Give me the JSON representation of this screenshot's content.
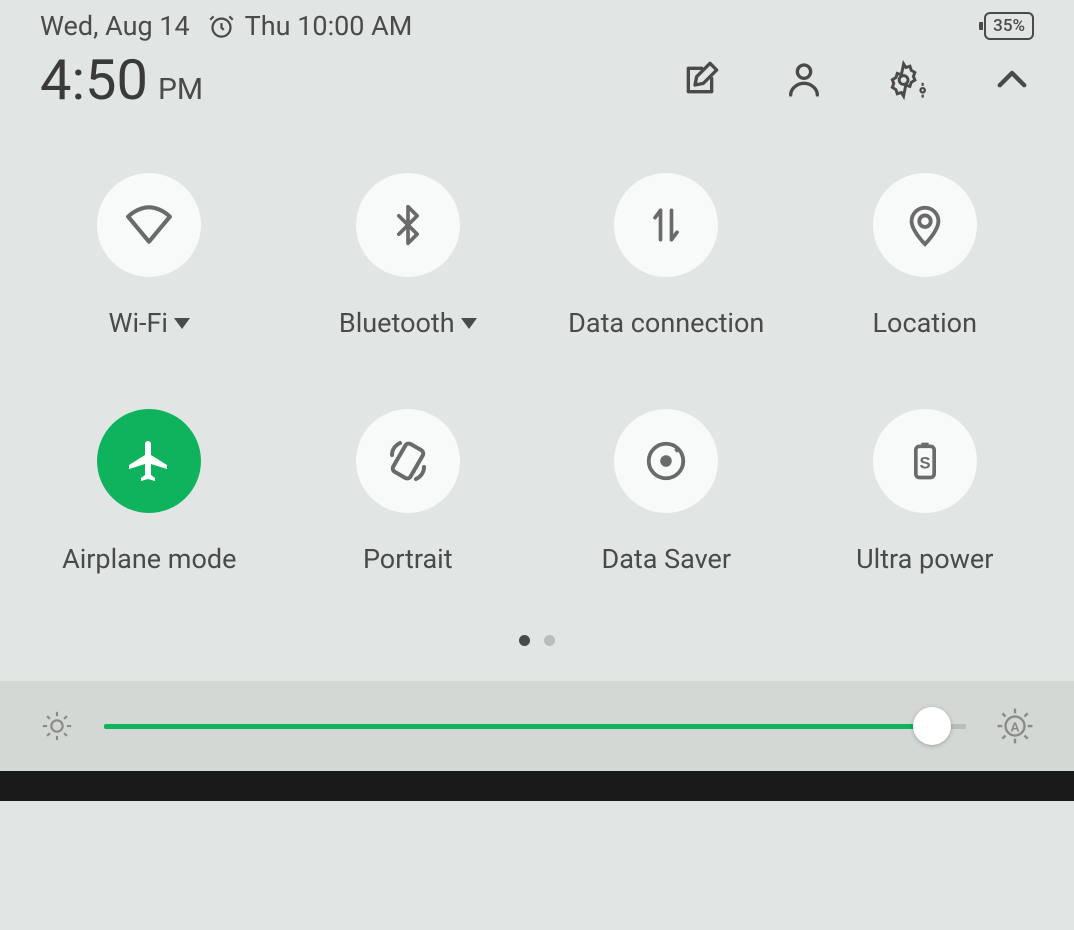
{
  "status": {
    "date": "Wed, Aug 14",
    "alarm_time": "Thu 10:00 AM",
    "battery": "35%"
  },
  "time": {
    "value": "4:50",
    "ampm": "PM"
  },
  "tiles": [
    {
      "label": "Wi-Fi",
      "icon": "wifi",
      "active": false,
      "dropdown": true
    },
    {
      "label": "Bluetooth",
      "icon": "bluetooth",
      "active": false,
      "dropdown": true
    },
    {
      "label": "Data connection",
      "icon": "data",
      "active": false,
      "dropdown": false
    },
    {
      "label": "Location",
      "icon": "location",
      "active": false,
      "dropdown": false
    },
    {
      "label": "Airplane mode",
      "icon": "airplane",
      "active": true,
      "dropdown": false
    },
    {
      "label": "Portrait",
      "icon": "portrait",
      "active": false,
      "dropdown": false
    },
    {
      "label": "Data Saver",
      "icon": "datasaver",
      "active": false,
      "dropdown": false
    },
    {
      "label": "Ultra power",
      "icon": "ultrapower",
      "active": false,
      "dropdown": false
    }
  ],
  "pages": {
    "current": 0,
    "total": 2
  },
  "brightness": {
    "percent": 97
  }
}
